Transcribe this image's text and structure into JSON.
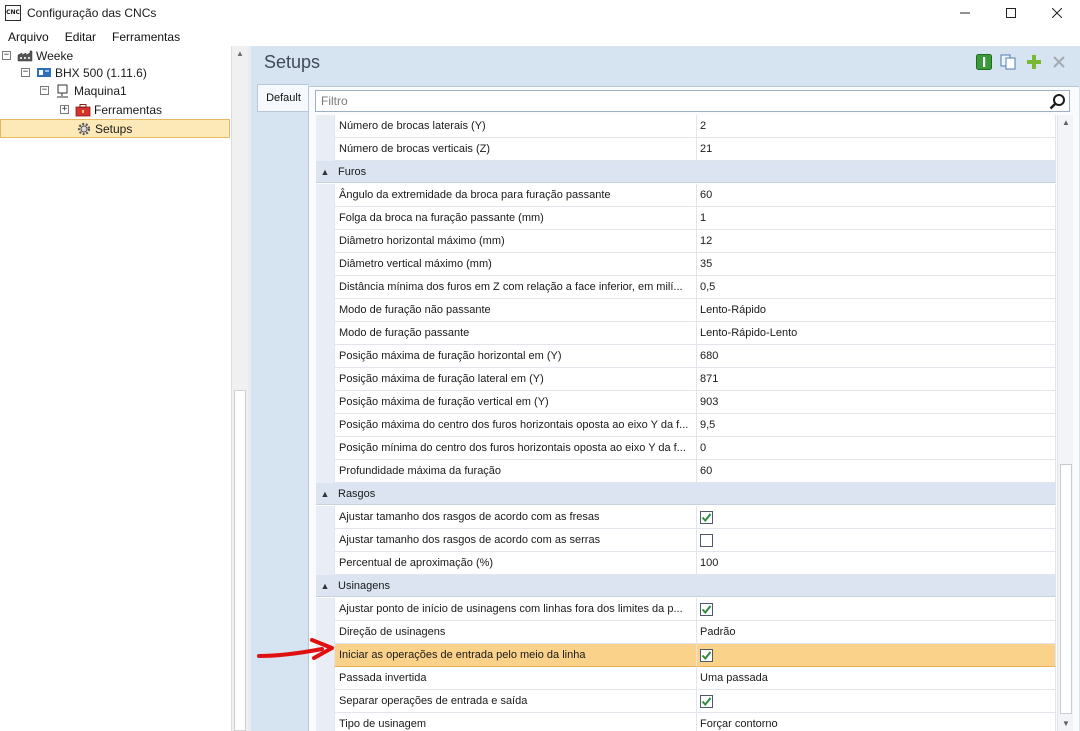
{
  "window": {
    "icon_text": "CNC",
    "title": "Configuração das CNCs",
    "minimize": "—",
    "maximize": "☐",
    "close": "✕"
  },
  "menu": [
    "Arquivo",
    "Editar",
    "Ferramentas"
  ],
  "tree": {
    "items": [
      {
        "label": "Weeke",
        "expander": "−",
        "icon": "factory-icon"
      },
      {
        "label": "BHX 500 (1.11.6)",
        "expander": "−",
        "icon": "machine-icon"
      },
      {
        "label": "Maquina1",
        "expander": "−",
        "icon": "workstation-icon"
      },
      {
        "label": "Ferramentas",
        "expander": "+",
        "icon": "toolbox-icon"
      },
      {
        "label": "Setups",
        "icon": "gear-icon",
        "selected": true
      }
    ]
  },
  "panel": {
    "title": "Setups",
    "tab": "Default",
    "filter_placeholder": "Filtro"
  },
  "grid": {
    "rows": [
      {
        "kind": "row",
        "name": "Número de brocas laterais (Y)",
        "value": "2"
      },
      {
        "kind": "row",
        "name": "Número de brocas verticais (Z)",
        "value": "21"
      },
      {
        "kind": "cat",
        "name": "Furos"
      },
      {
        "kind": "row",
        "name": "Ângulo da extremidade da broca para furação passante",
        "value": "60"
      },
      {
        "kind": "row",
        "name": "Folga da broca na furação passante (mm)",
        "value": "1"
      },
      {
        "kind": "row",
        "name": "Diâmetro horizontal máximo (mm)",
        "value": "12"
      },
      {
        "kind": "row",
        "name": "Diâmetro vertical máximo (mm)",
        "value": "35"
      },
      {
        "kind": "row",
        "name": "Distância mínima dos furos em Z com relação a face inferior, em milí...",
        "value": "0,5"
      },
      {
        "kind": "row",
        "name": "Modo de furação não passante",
        "value": "Lento-Rápido"
      },
      {
        "kind": "row",
        "name": "Modo de furação passante",
        "value": "Lento-Rápido-Lento"
      },
      {
        "kind": "row",
        "name": "Posição máxima de furação horizontal em (Y)",
        "value": "680"
      },
      {
        "kind": "row",
        "name": "Posição máxima de furação lateral em (Y)",
        "value": "871"
      },
      {
        "kind": "row",
        "name": "Posição máxima de furação vertical em (Y)",
        "value": "903"
      },
      {
        "kind": "row",
        "name": "Posição máxima do centro dos furos horizontais oposta ao eixo Y da f...",
        "value": "9,5"
      },
      {
        "kind": "row",
        "name": "Posição mínima do centro dos furos horizontais oposta ao eixo Y da f...",
        "value": "0"
      },
      {
        "kind": "row",
        "name": "Profundidade máxima da furação",
        "value": "60"
      },
      {
        "kind": "cat",
        "name": "Rasgos"
      },
      {
        "kind": "row",
        "name": "Ajustar tamanho dos rasgos de acordo com as fresas",
        "checkbox": true,
        "checked": true
      },
      {
        "kind": "row",
        "name": "Ajustar tamanho dos rasgos de acordo com as serras",
        "checkbox": true,
        "checked": false
      },
      {
        "kind": "row",
        "name": "Percentual de aproximação (%)",
        "value": "100"
      },
      {
        "kind": "cat",
        "name": "Usinagens"
      },
      {
        "kind": "row",
        "name": "Ajustar ponto de início de usinagens com linhas fora dos limites da p...",
        "checkbox": true,
        "checked": true
      },
      {
        "kind": "row",
        "name": "Direção de usinagens",
        "value": "Padrão"
      },
      {
        "kind": "row",
        "name": "Iniciar as operações de entrada pelo meio da linha",
        "checkbox": true,
        "checked": true,
        "highlight": true
      },
      {
        "kind": "row",
        "name": "Passada invertida",
        "value": "Uma passada"
      },
      {
        "kind": "row",
        "name": "Separar operações de entrada e saída",
        "checkbox": true,
        "checked": true
      },
      {
        "kind": "row",
        "name": "Tipo de usinagem",
        "value": "Forçar contorno"
      }
    ]
  },
  "colors": {
    "highlight_row": "#fbd28a",
    "category_bg": "#dbe4f0",
    "check_green": "#2e8b3e",
    "annotation_arrow": "#e01010"
  }
}
